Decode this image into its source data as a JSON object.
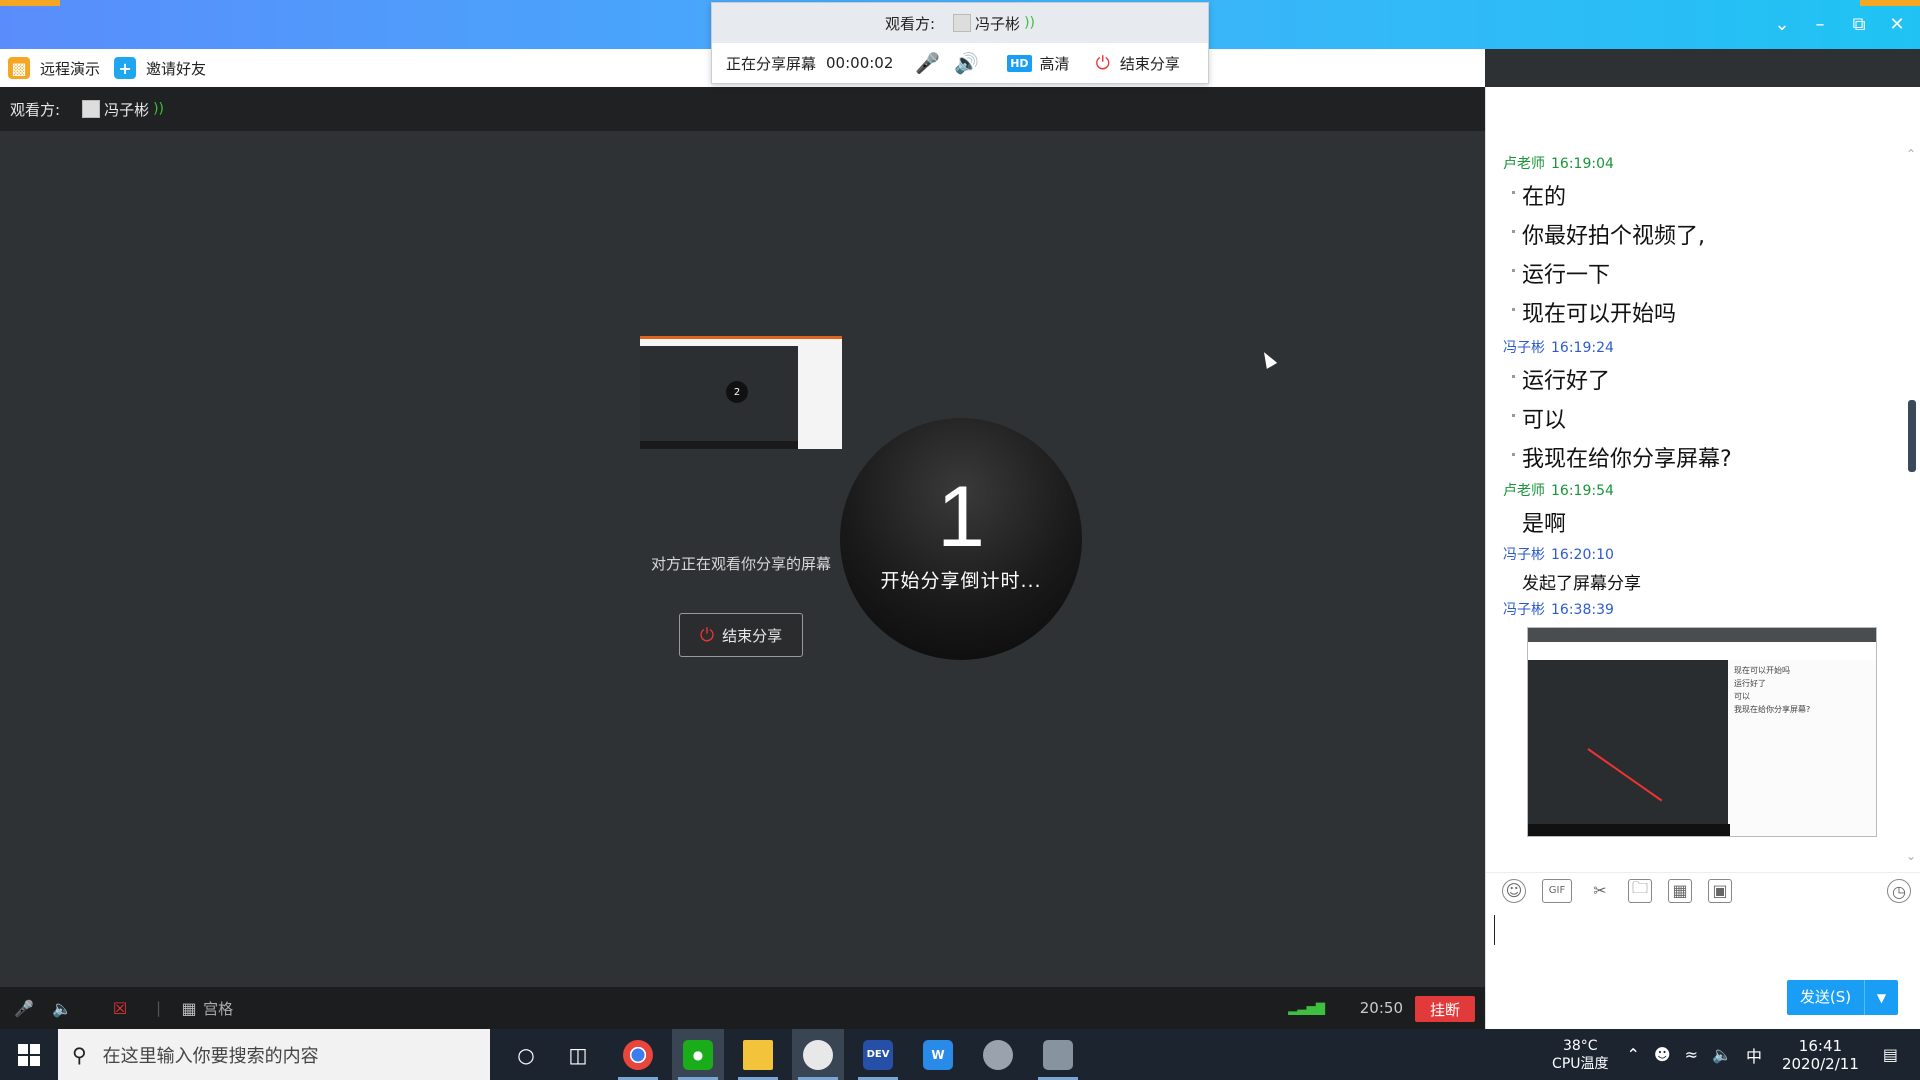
{
  "toolbar": {
    "remote_demo": "远程演示",
    "invite_friends": "邀请好友"
  },
  "share_popup": {
    "viewer_label": "观看方:",
    "viewer_name": "冯子彬",
    "status": "正在分享屏幕",
    "timer": "00:00:02",
    "hd_badge": "HD",
    "quality": "高清",
    "end_share": "结束分享"
  },
  "viewer_bar": {
    "label": "观看方:",
    "name": "冯子彬"
  },
  "stage": {
    "watching_text": "对方正在观看你分享的屏幕",
    "end_share_button": "结束分享",
    "countdown_number": "1",
    "countdown_label": "开始分享倒计时...",
    "thumb_number": "2"
  },
  "control_bar": {
    "grid_label": "宫格",
    "call_time": "20:50",
    "hangup": "挂断"
  },
  "chat": {
    "messages": [
      {
        "sender": "卢老师",
        "time": "16:19:04",
        "sender_color": "#19953a",
        "lines": [
          "在的",
          "你最好拍个视频了,",
          "运行一下",
          "现在可以开始吗"
        ]
      },
      {
        "sender": "冯子彬",
        "time": "16:19:24",
        "sender_color": "#2c5ad0",
        "lines": [
          "运行好了",
          "可以",
          "我现在给你分享屏幕?"
        ]
      },
      {
        "sender": "卢老师",
        "time": "16:19:54",
        "sender_color": "#19953a",
        "lines": [
          "是啊"
        ]
      },
      {
        "sender": "冯子彬",
        "time": "16:20:10",
        "sender_color": "#2c5ad0",
        "lines": [
          "发起了屏幕分享"
        ]
      },
      {
        "sender": "冯子彬",
        "time": "16:38:39",
        "sender_color": "#2c5ad0",
        "lines": []
      }
    ],
    "screenshot_lines": [
      "现在可以开始吗",
      "运行好了",
      "可以",
      "我现在给你分享屏幕?"
    ],
    "send_button": "发送(S)"
  },
  "taskbar": {
    "search_placeholder": "在这里输入你要搜索的内容",
    "temperature": "38°C",
    "temperature_label": "CPU温度",
    "ime": "中",
    "time": "16:41",
    "date": "2020/2/11"
  },
  "colors": {
    "titlebar_start": "#5a8dfb",
    "titlebar_end": "#1fc3f3",
    "hangup": "#e23a3a",
    "send": "#1a9ef5"
  }
}
